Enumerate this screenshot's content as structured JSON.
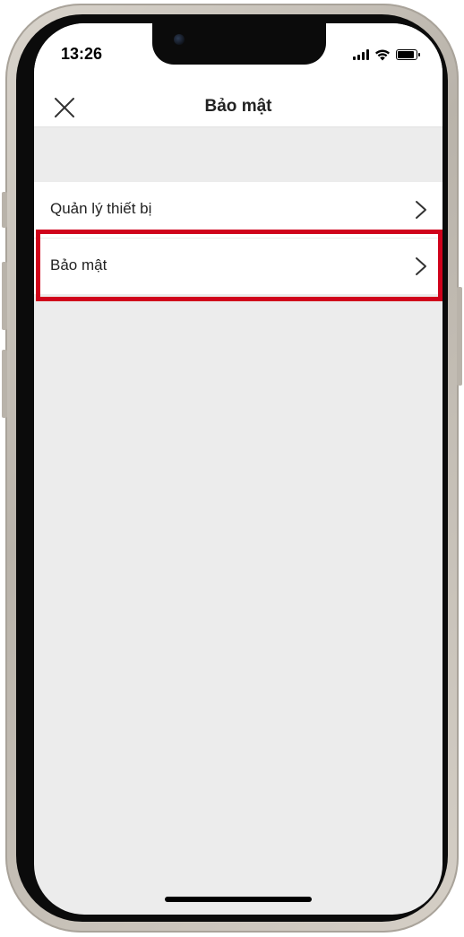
{
  "status_bar": {
    "time": "13:26",
    "battery_level": 0.9
  },
  "nav": {
    "title": "Bảo mật",
    "close_icon": "close-icon"
  },
  "settings": {
    "items": [
      {
        "label": "Quản lý thiết bị",
        "icon": "chevron-right-icon"
      },
      {
        "label": "Bảo mật",
        "icon": "chevron-right-icon"
      }
    ]
  },
  "colors": {
    "highlight": "#d0021b",
    "background": "#ececec",
    "surface": "#ffffff",
    "text": "#222222"
  }
}
